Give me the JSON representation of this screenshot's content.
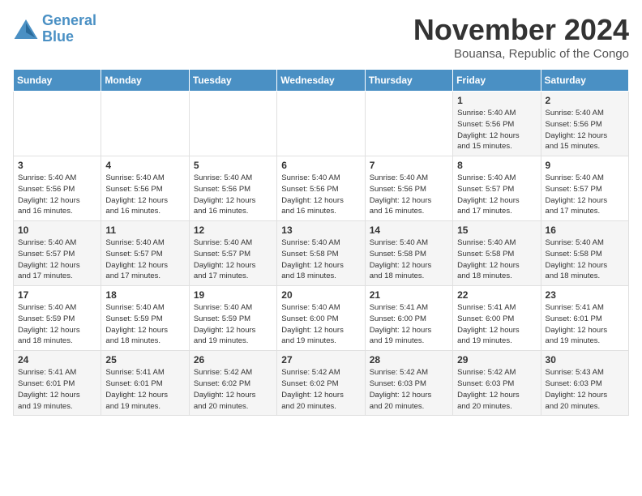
{
  "header": {
    "logo_line1": "General",
    "logo_line2": "Blue",
    "month": "November 2024",
    "location": "Bouansa, Republic of the Congo"
  },
  "weekdays": [
    "Sunday",
    "Monday",
    "Tuesday",
    "Wednesday",
    "Thursday",
    "Friday",
    "Saturday"
  ],
  "weeks": [
    [
      {
        "day": "",
        "info": ""
      },
      {
        "day": "",
        "info": ""
      },
      {
        "day": "",
        "info": ""
      },
      {
        "day": "",
        "info": ""
      },
      {
        "day": "",
        "info": ""
      },
      {
        "day": "1",
        "info": "Sunrise: 5:40 AM\nSunset: 5:56 PM\nDaylight: 12 hours\nand 15 minutes."
      },
      {
        "day": "2",
        "info": "Sunrise: 5:40 AM\nSunset: 5:56 PM\nDaylight: 12 hours\nand 15 minutes."
      }
    ],
    [
      {
        "day": "3",
        "info": "Sunrise: 5:40 AM\nSunset: 5:56 PM\nDaylight: 12 hours\nand 16 minutes."
      },
      {
        "day": "4",
        "info": "Sunrise: 5:40 AM\nSunset: 5:56 PM\nDaylight: 12 hours\nand 16 minutes."
      },
      {
        "day": "5",
        "info": "Sunrise: 5:40 AM\nSunset: 5:56 PM\nDaylight: 12 hours\nand 16 minutes."
      },
      {
        "day": "6",
        "info": "Sunrise: 5:40 AM\nSunset: 5:56 PM\nDaylight: 12 hours\nand 16 minutes."
      },
      {
        "day": "7",
        "info": "Sunrise: 5:40 AM\nSunset: 5:56 PM\nDaylight: 12 hours\nand 16 minutes."
      },
      {
        "day": "8",
        "info": "Sunrise: 5:40 AM\nSunset: 5:57 PM\nDaylight: 12 hours\nand 17 minutes."
      },
      {
        "day": "9",
        "info": "Sunrise: 5:40 AM\nSunset: 5:57 PM\nDaylight: 12 hours\nand 17 minutes."
      }
    ],
    [
      {
        "day": "10",
        "info": "Sunrise: 5:40 AM\nSunset: 5:57 PM\nDaylight: 12 hours\nand 17 minutes."
      },
      {
        "day": "11",
        "info": "Sunrise: 5:40 AM\nSunset: 5:57 PM\nDaylight: 12 hours\nand 17 minutes."
      },
      {
        "day": "12",
        "info": "Sunrise: 5:40 AM\nSunset: 5:57 PM\nDaylight: 12 hours\nand 17 minutes."
      },
      {
        "day": "13",
        "info": "Sunrise: 5:40 AM\nSunset: 5:58 PM\nDaylight: 12 hours\nand 18 minutes."
      },
      {
        "day": "14",
        "info": "Sunrise: 5:40 AM\nSunset: 5:58 PM\nDaylight: 12 hours\nand 18 minutes."
      },
      {
        "day": "15",
        "info": "Sunrise: 5:40 AM\nSunset: 5:58 PM\nDaylight: 12 hours\nand 18 minutes."
      },
      {
        "day": "16",
        "info": "Sunrise: 5:40 AM\nSunset: 5:58 PM\nDaylight: 12 hours\nand 18 minutes."
      }
    ],
    [
      {
        "day": "17",
        "info": "Sunrise: 5:40 AM\nSunset: 5:59 PM\nDaylight: 12 hours\nand 18 minutes."
      },
      {
        "day": "18",
        "info": "Sunrise: 5:40 AM\nSunset: 5:59 PM\nDaylight: 12 hours\nand 18 minutes."
      },
      {
        "day": "19",
        "info": "Sunrise: 5:40 AM\nSunset: 5:59 PM\nDaylight: 12 hours\nand 19 minutes."
      },
      {
        "day": "20",
        "info": "Sunrise: 5:40 AM\nSunset: 6:00 PM\nDaylight: 12 hours\nand 19 minutes."
      },
      {
        "day": "21",
        "info": "Sunrise: 5:41 AM\nSunset: 6:00 PM\nDaylight: 12 hours\nand 19 minutes."
      },
      {
        "day": "22",
        "info": "Sunrise: 5:41 AM\nSunset: 6:00 PM\nDaylight: 12 hours\nand 19 minutes."
      },
      {
        "day": "23",
        "info": "Sunrise: 5:41 AM\nSunset: 6:01 PM\nDaylight: 12 hours\nand 19 minutes."
      }
    ],
    [
      {
        "day": "24",
        "info": "Sunrise: 5:41 AM\nSunset: 6:01 PM\nDaylight: 12 hours\nand 19 minutes."
      },
      {
        "day": "25",
        "info": "Sunrise: 5:41 AM\nSunset: 6:01 PM\nDaylight: 12 hours\nand 19 minutes."
      },
      {
        "day": "26",
        "info": "Sunrise: 5:42 AM\nSunset: 6:02 PM\nDaylight: 12 hours\nand 20 minutes."
      },
      {
        "day": "27",
        "info": "Sunrise: 5:42 AM\nSunset: 6:02 PM\nDaylight: 12 hours\nand 20 minutes."
      },
      {
        "day": "28",
        "info": "Sunrise: 5:42 AM\nSunset: 6:03 PM\nDaylight: 12 hours\nand 20 minutes."
      },
      {
        "day": "29",
        "info": "Sunrise: 5:42 AM\nSunset: 6:03 PM\nDaylight: 12 hours\nand 20 minutes."
      },
      {
        "day": "30",
        "info": "Sunrise: 5:43 AM\nSunset: 6:03 PM\nDaylight: 12 hours\nand 20 minutes."
      }
    ]
  ]
}
